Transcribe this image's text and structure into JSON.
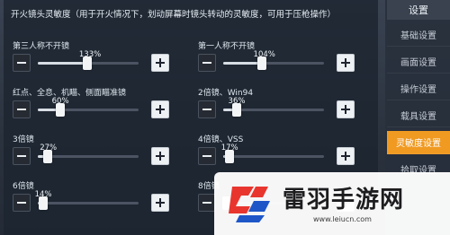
{
  "header": "开火镜头灵敏度（用于开火情况下，划动屏幕时镜头转动的灵敏度，可用于压枪操作）",
  "sliders": [
    {
      "label": "第三人称不开镜",
      "value": "133%",
      "fraction": 0.49
    },
    {
      "label": "第一人称不开镜",
      "value": "104%",
      "fraction": 0.38
    },
    {
      "label": "红点、全息、机瞄、侧面瞄准镜",
      "value": "60%",
      "fraction": 0.22
    },
    {
      "label": "2倍镜、Win94",
      "value": "36%",
      "fraction": 0.13
    },
    {
      "label": "3倍镜",
      "value": "27%",
      "fraction": 0.1
    },
    {
      "label": "4倍镜、VSS",
      "value": "17%",
      "fraction": 0.06
    },
    {
      "label": "6倍镜",
      "value": "14%",
      "fraction": 0.05
    },
    {
      "label": "8倍镜",
      "value": "",
      "fraction": 0.04
    }
  ],
  "sidebar": {
    "title": "设置",
    "items": [
      "基础设置",
      "画面设置",
      "操作设置",
      "载具设置",
      "灵敏度设置",
      "拾取设置"
    ],
    "active_index": 4
  },
  "watermark": {
    "brand": "雷羽手游网",
    "url": "www.leiucn.com"
  },
  "colors": {
    "accent": "#f09a22",
    "panel": "#1c2430"
  }
}
